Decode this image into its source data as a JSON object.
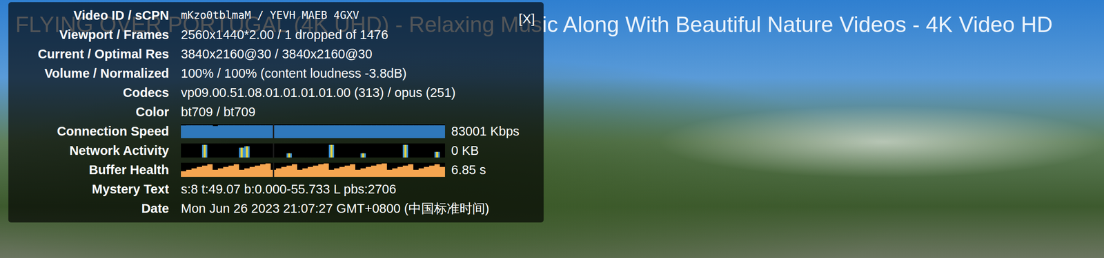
{
  "video": {
    "title": "FLYING OVER PORTUGAL (4K UHD) - Relaxing Music Along With Beautiful Nature Videos - 4K Video HD"
  },
  "stats_panel": {
    "close": "[X]",
    "rows": [
      {
        "kind": "mono",
        "label": "Video ID / sCPN",
        "value": "mKzo0tblmaM / YEVH MAEB 4GXV"
      },
      {
        "kind": "text",
        "label": "Viewport / Frames",
        "value": "2560x1440*2.00 / 1 dropped of 1476"
      },
      {
        "kind": "text",
        "label": "Current / Optimal Res",
        "value": "3840x2160@30 / 3840x2160@30"
      },
      {
        "kind": "text",
        "label": "Volume / Normalized",
        "value": "100% / 100% (content loudness -3.8dB)"
      },
      {
        "kind": "text",
        "label": "Codecs",
        "value": "vp09.00.51.08.01.01.01.01.00 (313) / opus (251)"
      },
      {
        "kind": "text",
        "label": "Color",
        "value": "bt709 / bt709"
      },
      {
        "kind": "bars",
        "label": "Connection Speed",
        "reading": "83001 Kbps",
        "color": "#2f78bb",
        "max": 90000,
        "values": [
          82000,
          83000,
          83000,
          83000,
          83000,
          83000,
          78000,
          83000,
          83000,
          83000,
          83000,
          83000,
          83000,
          83000,
          83000,
          83000,
          83000,
          83000,
          83000,
          83000,
          83000,
          83000,
          83000,
          83000,
          83000,
          83000,
          83000,
          83000,
          83000,
          83000,
          83000,
          83000,
          83000,
          83000,
          83000,
          83000,
          83000,
          83000,
          83000,
          83000,
          83000,
          83000,
          83000,
          83000,
          83000,
          83000,
          83000,
          83000,
          83000,
          83001
        ]
      },
      {
        "kind": "activity",
        "label": "Network Activity",
        "reading": "0 KB",
        "color": "#3a8fd4",
        "max": 1000,
        "values": [
          0,
          0,
          0,
          0,
          900,
          0,
          0,
          0,
          0,
          0,
          0,
          700,
          800,
          0,
          0,
          0,
          0,
          0,
          0,
          0,
          300,
          0,
          0,
          0,
          0,
          0,
          0,
          0,
          900,
          0,
          0,
          0,
          0,
          0,
          300,
          0,
          0,
          0,
          0,
          0,
          0,
          0,
          900,
          0,
          0,
          0,
          0,
          0,
          400,
          0
        ]
      },
      {
        "kind": "sawtooth",
        "label": "Buffer Health",
        "reading": "6.85 s",
        "color": "#f5a550",
        "max": 10,
        "values": [
          4,
          5,
          6,
          7,
          8,
          9,
          5,
          6,
          7,
          8,
          9,
          5,
          6,
          7,
          8,
          9,
          9.5,
          5,
          6,
          7,
          8,
          9,
          5,
          6,
          7,
          8,
          9,
          9.5,
          5,
          6,
          7,
          8,
          9,
          5,
          6,
          7,
          8,
          9,
          9.5,
          5,
          6,
          7,
          8,
          9,
          5,
          6,
          7,
          8,
          9,
          7
        ]
      },
      {
        "kind": "text",
        "label": "Mystery Text",
        "value": "s:8 t:49.07 b:0.000-55.733 L pbs:2706"
      },
      {
        "kind": "text",
        "label": "Date",
        "value": "Mon Jun 26 2023 21:07:27 GMT+0800 (中国标准时间)"
      }
    ]
  }
}
